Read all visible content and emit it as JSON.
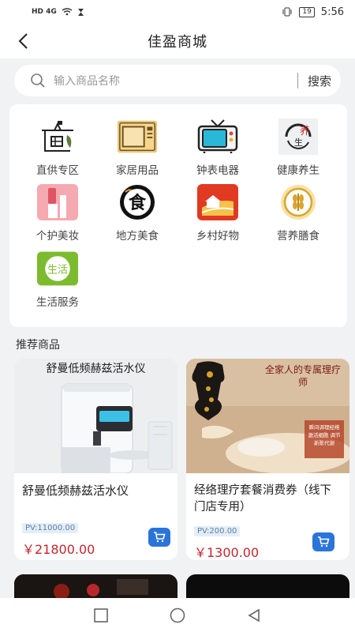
{
  "statusbar": {
    "network": "HD 4G",
    "battery": "19",
    "time": "5:56"
  },
  "appbar": {
    "title": "佳盈商城"
  },
  "search": {
    "placeholder": "输入商品名称",
    "button": "搜索"
  },
  "categories": [
    {
      "label": "直供专区",
      "icon": "store-icon"
    },
    {
      "label": "家居用品",
      "icon": "microwave-icon"
    },
    {
      "label": "钟表电器",
      "icon": "tv-icon"
    },
    {
      "label": "健康养生",
      "icon": "health-icon"
    },
    {
      "label": "个护美妆",
      "icon": "lipstick-icon"
    },
    {
      "label": "地方美食",
      "icon": "food-icon"
    },
    {
      "label": "乡村好物",
      "icon": "village-icon"
    },
    {
      "label": "营养膳食",
      "icon": "grain-icon"
    },
    {
      "label": "生活服务",
      "icon": "life-service-icon"
    }
  ],
  "cat_icon_text": {
    "food": "食",
    "life": "生活",
    "health_top": "养",
    "health_bottom": "生"
  },
  "section": {
    "title": "推荐商品"
  },
  "products": [
    {
      "image_caption": "舒曼低频赫兹活水仪",
      "name": "舒曼低频赫兹活水仪",
      "pv": "PV:11000.00",
      "price": "￥21800.00"
    },
    {
      "image_caption": "全家人的专属理疗师",
      "image_note": "瞬间调理经络 激活细胞 调节新陈代谢",
      "name": "经络理疗套餐消费券（线下门店专用）",
      "pv": "PV:200.00",
      "price": "￥1300.00"
    }
  ],
  "colors": {
    "accent_blue": "#2b74d9",
    "price_red": "#c0272d",
    "background": "#f1f2f4"
  }
}
